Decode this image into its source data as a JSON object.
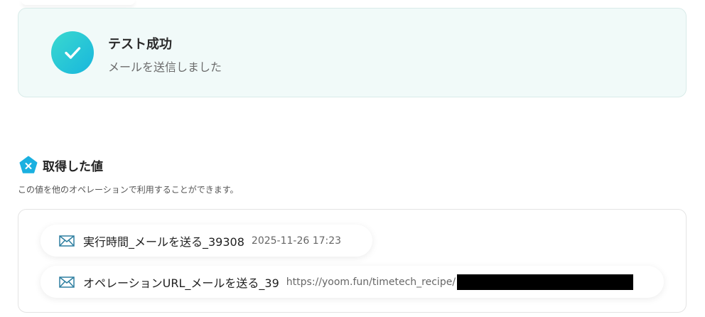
{
  "success": {
    "title": "テスト成功",
    "subtitle": "メールを送信しました",
    "icon": "check-icon"
  },
  "section": {
    "title": "取得した値",
    "description": "この値を他のオペレーションで利用することができます。",
    "icon": "close-badge-icon"
  },
  "values": [
    {
      "label": "実行時間_メールを送る_39308",
      "value": "2025-11-26 17:23",
      "icon": "mail-icon"
    },
    {
      "label": "オペレーションURL_メールを送る_39",
      "value": "https://yoom.fun/timetech_recipe/",
      "icon": "mail-icon",
      "redacted": true
    }
  ],
  "colors": {
    "success_bg": "#f1faf9",
    "check_gradient_start": "#3ad9cf",
    "check_gradient_end": "#18b6dd",
    "section_icon": "#1ab0e0",
    "mail_icon_stroke": "#2e7fa0"
  }
}
